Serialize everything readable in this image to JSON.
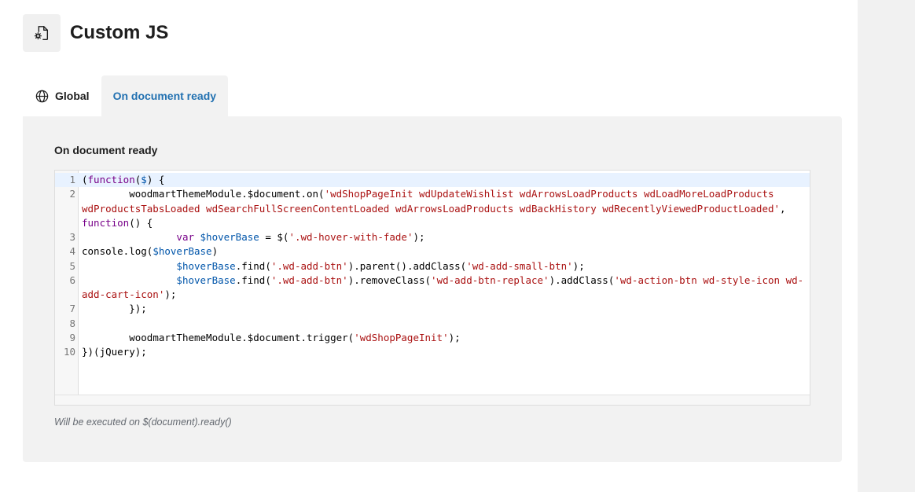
{
  "header": {
    "title": "Custom JS",
    "icon": "js-file-settings-icon"
  },
  "tabs": [
    {
      "label": "Global",
      "icon": "globe-icon",
      "active": false
    },
    {
      "label": "On document ready",
      "active": true
    }
  ],
  "section": {
    "label": "On document ready",
    "hint": "Will be executed on $(document).ready()"
  },
  "editor": {
    "lines": [
      {
        "number": "1",
        "text": "(function($) {"
      },
      {
        "number": "2",
        "text": "        woodmartThemeModule.$document.on('wdShopPageInit wdUpdateWishlist wdArrowsLoadProducts wdLoadMoreLoadProducts wdProductsTabsLoaded wdSearchFullScreenContentLoaded wdArrowsLoadProducts wdBackHistory wdRecentlyViewedProductLoaded', function() {"
      },
      {
        "number": "3",
        "text": "                var $hoverBase = $('.wd-hover-with-fade');"
      },
      {
        "number": "4",
        "text": "console.log($hoverBase)"
      },
      {
        "number": "5",
        "text": "                $hoverBase.find('.wd-add-btn').parent().addClass('wd-add-small-btn');"
      },
      {
        "number": "6",
        "text": "                $hoverBase.find('.wd-add-btn').removeClass('wd-add-btn-replace').addClass('wd-action-btn wd-style-icon wd-add-cart-icon');"
      },
      {
        "number": "7",
        "text": "        });"
      },
      {
        "number": "8",
        "text": ""
      },
      {
        "number": "9",
        "text": "        woodmartThemeModule.$document.trigger('wdShopPageInit');"
      },
      {
        "number": "10",
        "text": "})(jQuery);"
      }
    ]
  },
  "colors": {
    "accent": "#2271b1",
    "keyword": "#770088",
    "variable": "#0055aa",
    "string": "#aa1111"
  }
}
